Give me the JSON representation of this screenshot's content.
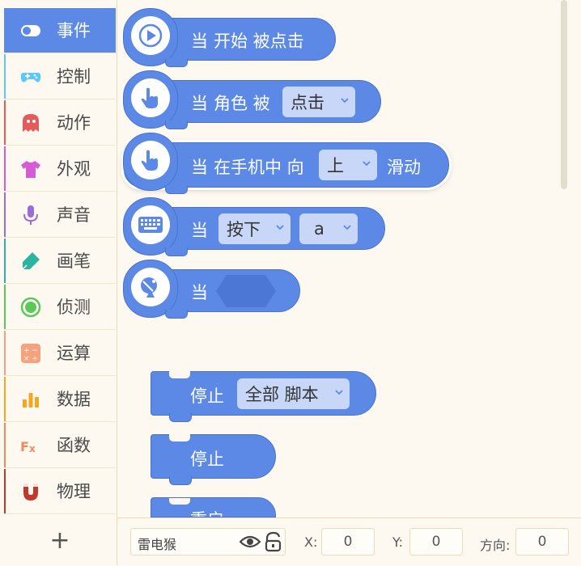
{
  "sidebar": {
    "categories": [
      {
        "label": "事件",
        "icon": "toggle-icon",
        "color": "#5d89e6",
        "active": true
      },
      {
        "label": "控制",
        "icon": "gamepad-icon",
        "color": "#5ac8fa"
      },
      {
        "label": "动作",
        "icon": "ghost-icon",
        "color": "#e55a5a"
      },
      {
        "label": "外观",
        "icon": "shirt-icon",
        "color": "#d65cd6"
      },
      {
        "label": "声音",
        "icon": "microphone-icon",
        "color": "#9b6bd8"
      },
      {
        "label": "画笔",
        "icon": "pen-icon",
        "color": "#2bb5a0"
      },
      {
        "label": "侦测",
        "icon": "radar-icon",
        "color": "#5cc85c"
      },
      {
        "label": "运算",
        "icon": "calculator-icon",
        "color": "#f5a37e"
      },
      {
        "label": "数据",
        "icon": "bar-chart-icon",
        "color": "#f5a623"
      },
      {
        "label": "函数",
        "icon": "function-icon",
        "color": "#f08a5d"
      },
      {
        "label": "物理",
        "icon": "magnet-icon",
        "color": "#c0392b"
      }
    ],
    "add_label": "+"
  },
  "blocks": {
    "start_click": {
      "when": "当",
      "text": "开始 被点击"
    },
    "sprite_click": {
      "when": "当",
      "text": "角色 被",
      "dropdown": "点击"
    },
    "swipe": {
      "when": "当",
      "text": "在手机中 向",
      "dropdown": "上",
      "suffix": "滑动"
    },
    "key": {
      "when": "当",
      "dropdown1": "按下",
      "dropdown2": "a"
    },
    "broadcast": {
      "when": "当"
    },
    "stop_scripts": {
      "text": "停止",
      "dropdown": "全部 脚本"
    },
    "stop": {
      "text": "停止"
    },
    "restart": {
      "text": "重启"
    }
  },
  "statusbar": {
    "sprite_name": "雷电猴",
    "x_label": "X:",
    "x_value": "0",
    "y_label": "Y:",
    "y_value": "0",
    "dir_label": "方向:",
    "dir_value": "0"
  }
}
